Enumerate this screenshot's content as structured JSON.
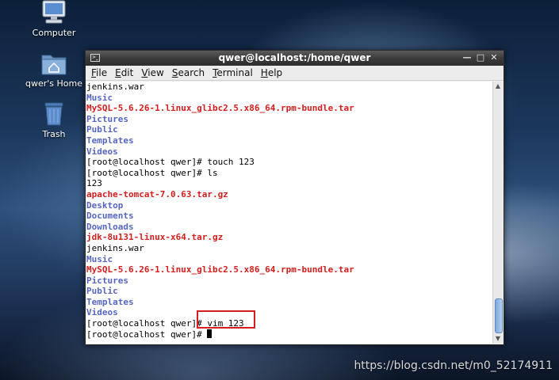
{
  "desktop": {
    "icons": [
      {
        "label": "Computer",
        "icon": "computer-icon"
      },
      {
        "label": "qwer's Home",
        "icon": "home-folder-icon"
      },
      {
        "label": "Trash",
        "icon": "trash-icon"
      }
    ]
  },
  "window": {
    "title": "qwer@localhost:/home/qwer",
    "controls": [
      "minimize",
      "maximize",
      "close"
    ],
    "menu": [
      "File",
      "Edit",
      "View",
      "Search",
      "Terminal",
      "Help"
    ]
  },
  "terminal": {
    "lines": [
      {
        "text": "jenkins.war",
        "kind": "plain"
      },
      {
        "text": "Music",
        "kind": "dir"
      },
      {
        "text": "MySQL-5.6.26-1.linux_glibc2.5.x86_64.rpm-bundle.tar",
        "kind": "archive"
      },
      {
        "text": "Pictures",
        "kind": "dir"
      },
      {
        "text": "Public",
        "kind": "dir"
      },
      {
        "text": "Templates",
        "kind": "dir"
      },
      {
        "text": "Videos",
        "kind": "dir"
      },
      {
        "text": "[root@localhost qwer]# touch 123",
        "kind": "plain"
      },
      {
        "text": "[root@localhost qwer]# ls",
        "kind": "plain"
      },
      {
        "text": "123",
        "kind": "plain"
      },
      {
        "text": "apache-tomcat-7.0.63.tar.gz",
        "kind": "archive"
      },
      {
        "text": "Desktop",
        "kind": "dir"
      },
      {
        "text": "Documents",
        "kind": "dir"
      },
      {
        "text": "Downloads",
        "kind": "dir"
      },
      {
        "text": "jdk-8u131-linux-x64.tar.gz",
        "kind": "archive"
      },
      {
        "text": "jenkins.war",
        "kind": "plain"
      },
      {
        "text": "Music",
        "kind": "dir"
      },
      {
        "text": "MySQL-5.6.26-1.linux_glibc2.5.x86_64.rpm-bundle.tar",
        "kind": "archive"
      },
      {
        "text": "Pictures",
        "kind": "dir"
      },
      {
        "text": "Public",
        "kind": "dir"
      },
      {
        "text": "Templates",
        "kind": "dir"
      },
      {
        "text": "Videos",
        "kind": "dir"
      },
      {
        "text": "[root@localhost qwer]# vim 123",
        "kind": "plain"
      },
      {
        "text": "[root@localhost qwer]# ",
        "kind": "prompt"
      }
    ],
    "scroll_position": 0.9
  },
  "colors": {
    "directory": "#5566c0",
    "archive": "#d41d1d",
    "annotation": "#d51e1e"
  },
  "watermark": "https://blog.csdn.net/m0_52174911"
}
